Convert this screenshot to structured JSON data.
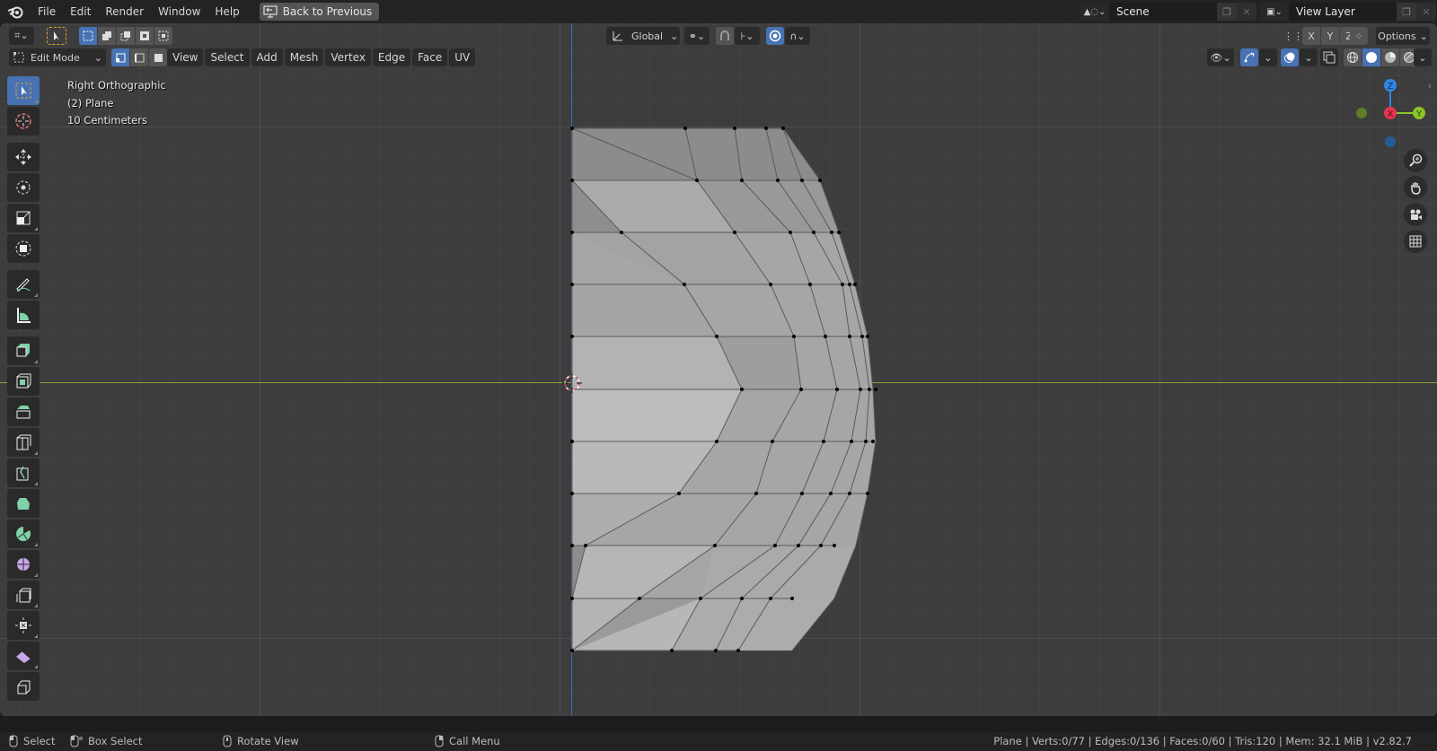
{
  "topbar": {
    "menu": [
      "File",
      "Edit",
      "Render",
      "Window",
      "Help"
    ],
    "back_button": "Back to Previous",
    "scene": "Scene",
    "view_layer": "View Layer"
  },
  "header": {
    "transform_orientation": "Global",
    "axis": [
      "X",
      "Y",
      "Z"
    ],
    "options": "Options",
    "mode": "Edit Mode",
    "menus": [
      "View",
      "Select",
      "Add",
      "Mesh",
      "Vertex",
      "Edge",
      "Face",
      "UV"
    ]
  },
  "overlay": {
    "view_name": "Right Orthographic",
    "object": "(2) Plane",
    "scale": "10 Centimeters"
  },
  "toolbar": {
    "tools": [
      "select-box",
      "cursor",
      "move",
      "rotate",
      "scale",
      "transform",
      "annotate",
      "measure",
      "extrude-region",
      "inset-faces",
      "bevel",
      "loop-cut",
      "knife",
      "poly-build",
      "spin",
      "smooth",
      "edge-slide",
      "shrink-fatten",
      "shear",
      "rip-region"
    ],
    "active": "select-box"
  },
  "gizmo": {
    "axes": {
      "x": "X",
      "y": "Y",
      "z": "Z"
    },
    "colors": {
      "x": "#e8344f",
      "y": "#8bc42a",
      "z": "#2f86e6"
    }
  },
  "status": {
    "hints": [
      {
        "icon": "mouse-left",
        "label": "Select"
      },
      {
        "icon": "mouse-drag",
        "label": "Box Select"
      },
      {
        "icon": "mouse-middle",
        "label": "Rotate View"
      },
      {
        "icon": "mouse-right",
        "label": "Call Menu"
      }
    ],
    "stats": "Plane | Verts:0/77 | Edges:0/136 | Faces:0/60 | Tris:120 | Mem: 32.1 MiB | v2.82.7"
  },
  "colors": {
    "accent": "#4772b3",
    "x_axis_line": "#8aa232",
    "z_axis_line": "#3a6fb6",
    "mesh_face": "#a9a9a9"
  }
}
